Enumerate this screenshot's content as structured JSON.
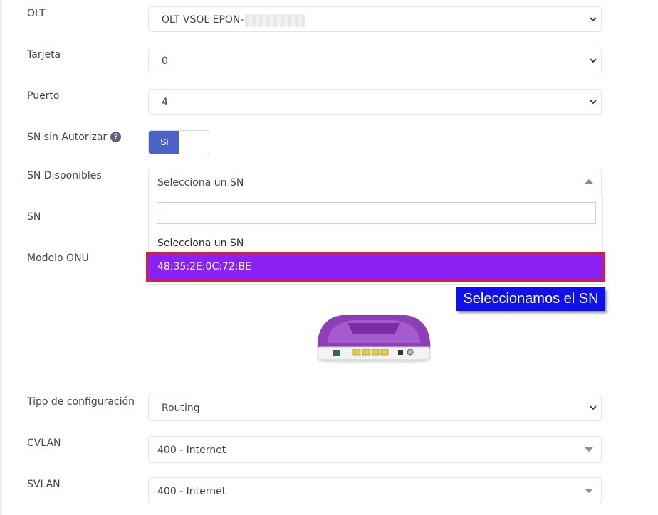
{
  "form": {
    "olt": {
      "label": "OLT",
      "value": "OLT VSOL EPON-"
    },
    "tarjeta": {
      "label": "Tarjeta",
      "value": "0"
    },
    "puerto": {
      "label": "Puerto",
      "value": "4"
    },
    "sn_sin_autorizar": {
      "label": "SN sin Autorizar",
      "toggle_label": "Si",
      "toggle_on": true,
      "help_icon": "question-circle-icon"
    },
    "sn_disponibles": {
      "label": "SN Disponibles",
      "value": "Selecciona un SN",
      "search_placeholder": "",
      "options": [
        "Selecciona un SN",
        "48:35:2E:0C:72:BE"
      ],
      "highlighted_option": "48:35:2E:0C:72:BE"
    },
    "sn": {
      "label": "SN"
    },
    "modelo_onu": {
      "label": "Modelo ONU"
    },
    "tipo_configuracion": {
      "label": "Tipo de configuración",
      "value": "Routing"
    },
    "cvlan": {
      "label": "CVLAN",
      "value": "400 - Internet"
    },
    "svlan": {
      "label": "SVLAN",
      "value": "400 - Internet"
    }
  },
  "annotation": {
    "text": "Seleccionamos el SN"
  },
  "colors": {
    "highlight": "#8a22f5",
    "highlight_border": "#e02020",
    "callout_bg": "#1010ee",
    "toggle_on": "#4b63c4"
  }
}
